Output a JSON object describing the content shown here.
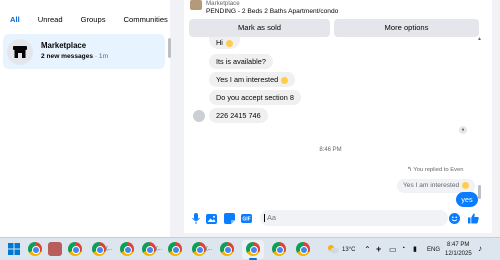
{
  "left_panel": {
    "filters": [
      "All",
      "Unread",
      "Groups",
      "Communities"
    ],
    "active_filter": "All",
    "chat": {
      "name": "Marketplace",
      "preview_bold": "2 new messages",
      "preview_time": " · 1m",
      "icon": "store-icon"
    }
  },
  "conversation": {
    "listing_label": "Marketplace",
    "listing_title": "PENDING - 2 Beds 2 Baths Apartment/condo",
    "buttons": {
      "mark_sold": "Mark as sold",
      "more_options": "More options"
    },
    "messages": [
      {
        "text": "Hi"
      },
      {
        "text": "Its is available?"
      },
      {
        "text": "Yes I am interested"
      },
      {
        "text": "Do you accept section 8"
      },
      {
        "text": "226 2415 746"
      }
    ],
    "time_separator": "8:46 PM",
    "reply_note": "You replied to Even",
    "quoted_text": "Yes I am interested",
    "my_message": "yes"
  },
  "composer": {
    "placeholder": "Aa",
    "icons": [
      "microphone-icon",
      "image-icon",
      "sticker-icon",
      "gif-icon",
      "emoji-icon",
      "like-icon"
    ]
  },
  "taskbar": {
    "weather": "13°C",
    "language": "ENG",
    "time": "8:47 PM",
    "date": "12/1/2025",
    "app_labels": [
      "(...",
      "(...",
      "(..."
    ]
  },
  "colors": {
    "accent": "#0a7cff",
    "selected_chat": "#e7f3ff",
    "bubble": "#f0f0f0"
  }
}
